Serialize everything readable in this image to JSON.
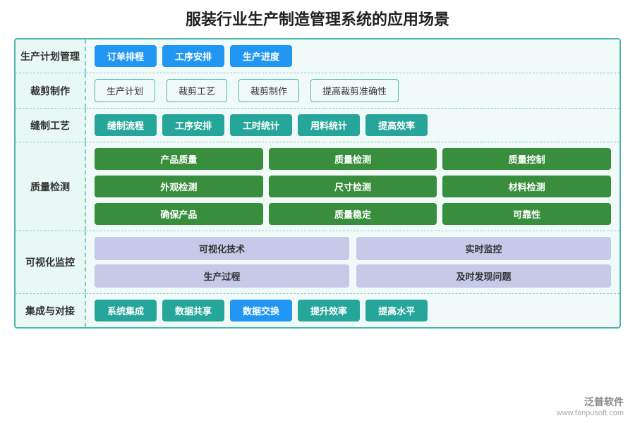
{
  "title": "服装行业生产制造管理系统的应用场景",
  "rows": [
    {
      "label": "生产计划管理",
      "type": "blue-btns",
      "items": [
        "订单排程",
        "工序安排",
        "生产进度"
      ]
    },
    {
      "label": "裁剪制作",
      "type": "cutting",
      "items": [
        "生产计划",
        "裁剪工艺",
        "裁剪制作",
        "提高裁剪准确性"
      ]
    },
    {
      "label": "缝制工艺",
      "type": "teal-btns",
      "items": [
        "缝制流程",
        "工序安排",
        "工时统计",
        "用料统计",
        "提高效率"
      ]
    },
    {
      "label": "质量检测",
      "type": "quality",
      "items": [
        "产品质量",
        "质量检测",
        "质量控制",
        "外观检测",
        "尺寸检测",
        "材料检测",
        "确保产品",
        "质量稳定",
        "可靠性"
      ]
    },
    {
      "label": "可视化监控",
      "type": "monitor",
      "rows": [
        [
          "可视化技术",
          "实时监控"
        ],
        [
          "生产过程",
          "及时发现问题"
        ]
      ]
    },
    {
      "label": "集成与对接",
      "type": "integration",
      "items": [
        "系统集成",
        "数据共享",
        "数据交换",
        "提升效率",
        "提高水平"
      ]
    }
  ],
  "watermark": {
    "line1": "泛普软件",
    "line2": "www.fanpusoft.com"
  }
}
